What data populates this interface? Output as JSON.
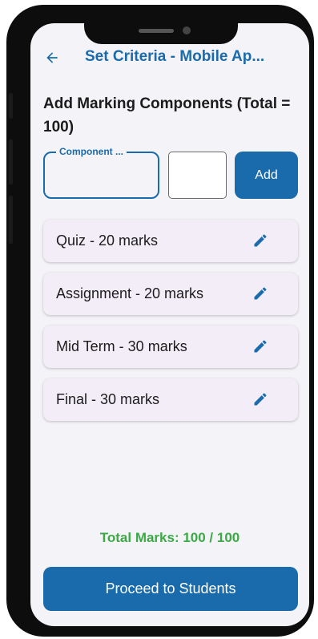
{
  "header": {
    "title": "Set Criteria - Mobile Ap...",
    "back_icon": "arrow-left-icon"
  },
  "section_title": "Add Marking Components (Total = 100)",
  "form": {
    "component_label": "Component ...",
    "component_value": "",
    "marks_value": "",
    "add_label": "Add"
  },
  "components": [
    {
      "label": "Quiz - 20 marks",
      "icon": "pencil-icon"
    },
    {
      "label": "Assignment - 20 marks",
      "icon": "pencil-icon"
    },
    {
      "label": "Mid Term - 30 marks",
      "icon": "pencil-icon"
    },
    {
      "label": "Final - 30 marks",
      "icon": "pencil-icon"
    }
  ],
  "total_text": "Total Marks: 100 / 100",
  "proceed_label": "Proceed to Students",
  "colors": {
    "primary": "#1a6bab",
    "success": "#3da946",
    "card": "#f3edf7",
    "background": "#f4f3f7"
  }
}
